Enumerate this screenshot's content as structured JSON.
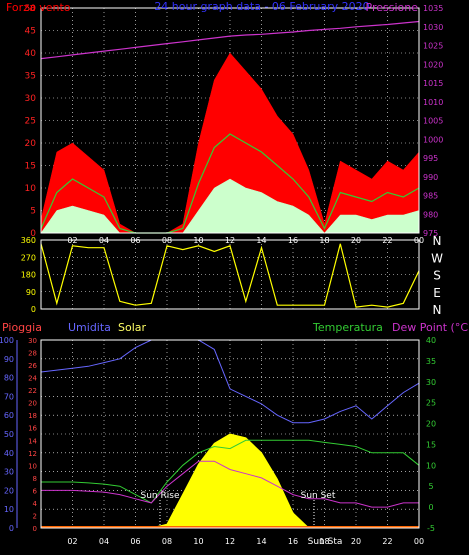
{
  "colors": {
    "background": "#000000",
    "frame": "#ffffff",
    "grid": "#ffffff",
    "wind_gust": "#ff0000",
    "wind_avg": "#33cc33",
    "wind_min": "#ccffcc",
    "pressure": "#cc33cc",
    "direction": "#ffff00",
    "humidity": "#6666ff",
    "rain": "#ff4444",
    "temperature": "#33cc33",
    "dew_point": "#cc33cc",
    "solar": "#ffff00",
    "temp_axis": "#33cc33"
  },
  "top_chart": {
    "title": "24 hour graph data - 06 February 2020",
    "left_label": "Forza vento",
    "right_label": "Pressione",
    "left_ticks": [
      "0",
      "5",
      "10",
      "15",
      "20",
      "25",
      "30",
      "35",
      "40",
      "45",
      "50"
    ],
    "right_ticks": [
      "975",
      "980",
      "985",
      "990",
      "995",
      "1000",
      "1005",
      "1010",
      "1015",
      "1020",
      "1025",
      "1030",
      "1035"
    ],
    "x_ticks": [
      "02",
      "04",
      "06",
      "08",
      "10",
      "12",
      "14",
      "16",
      "18",
      "20",
      "22",
      "00"
    ]
  },
  "direction_chart": {
    "left_ticks": [
      "0",
      "90",
      "180",
      "270",
      "360"
    ],
    "compass": [
      "N",
      "W",
      "S",
      "E",
      "N"
    ],
    "x_ticks": [
      "02",
      "04",
      "06",
      "08",
      "10",
      "12",
      "14",
      "16",
      "18",
      "20",
      "22",
      "00"
    ]
  },
  "bottom_chart": {
    "labels": {
      "rain": "Pioggia",
      "humidity": "Umidita",
      "solar": "Solar",
      "temperature": "Temperatura",
      "dew_point": "Dew Point (°C)"
    },
    "humidity_ticks": [
      "0",
      "10",
      "20",
      "30",
      "40",
      "50",
      "60",
      "70",
      "80",
      "90",
      "100"
    ],
    "rain_ticks": [
      "0",
      "2",
      "4",
      "6",
      "8",
      "10",
      "12",
      "14",
      "16",
      "18",
      "20",
      "22",
      "24",
      "26",
      "28",
      "30"
    ],
    "temp_ticks": [
      "-5",
      "0",
      "5",
      "10",
      "15",
      "20",
      "25",
      "30",
      "35",
      "40"
    ],
    "x_ticks": [
      "02",
      "04",
      "06",
      "08",
      "10",
      "12",
      "14",
      "16",
      "18",
      "20",
      "22",
      "00"
    ],
    "sunrise_label": "Sun Rise",
    "sunset_label": "Sun Set",
    "sunset_extra_label": "Sun Sta"
  },
  "chart_data": [
    {
      "type": "line",
      "title": "24 hour graph data - 06 February 2020",
      "ylabel": "Forza vento",
      "y2label": "Pressione",
      "ylim": [
        0,
        50
      ],
      "y2lim": [
        975,
        1035
      ],
      "x_hours": [
        0,
        1,
        2,
        3,
        4,
        5,
        6,
        7,
        8,
        9,
        10,
        11,
        12,
        13,
        14,
        15,
        16,
        17,
        18,
        19,
        20,
        21,
        22,
        23,
        24
      ],
      "series": [
        {
          "values": [
            3,
            18,
            20,
            17,
            14,
            2,
            0,
            0,
            0,
            2,
            20,
            34,
            40,
            36,
            32,
            26,
            22,
            14,
            2,
            16,
            14,
            12,
            16,
            14,
            18
          ]
        },
        {
          "values": [
            1,
            9,
            12,
            10,
            8,
            1,
            0,
            0,
            0,
            1,
            11,
            19,
            22,
            20,
            18,
            15,
            12,
            8,
            1,
            9,
            8,
            7,
            9,
            8,
            10
          ]
        },
        {
          "values": [
            0,
            5,
            6,
            5,
            4,
            0,
            0,
            0,
            0,
            0,
            5,
            10,
            12,
            10,
            9,
            7,
            6,
            4,
            0,
            4,
            4,
            3,
            4,
            4,
            5
          ]
        },
        {
          "values": [
            1021.5,
            1022,
            1022.5,
            1023,
            1023.5,
            1024,
            1024.5,
            1025,
            1025.5,
            1026,
            1026.5,
            1027,
            1027.5,
            1027.8,
            1028,
            1028.3,
            1028.6,
            1029,
            1029.3,
            1029.6,
            1030,
            1030.3,
            1030.6,
            1031,
            1031.4
          ]
        }
      ]
    },
    {
      "type": "line",
      "ylim": [
        0,
        360
      ],
      "x_hours": [
        0,
        1,
        2,
        3,
        4,
        5,
        6,
        7,
        8,
        9,
        10,
        11,
        12,
        13,
        14,
        15,
        16,
        17,
        18,
        19,
        20,
        21,
        22,
        23,
        24
      ],
      "values": [
        340,
        30,
        330,
        320,
        320,
        40,
        20,
        30,
        330,
        310,
        330,
        300,
        330,
        40,
        320,
        20,
        20,
        20,
        20,
        340,
        10,
        20,
        10,
        30,
        200
      ]
    },
    {
      "type": "line",
      "x_hours": [
        0,
        1,
        2,
        3,
        4,
        5,
        6,
        7,
        8,
        9,
        10,
        11,
        12,
        13,
        14,
        15,
        16,
        17,
        18,
        19,
        20,
        21,
        22,
        23,
        24
      ],
      "series": [
        {
          "values": [
            83,
            84,
            85,
            86,
            88,
            90,
            96,
            100,
            100,
            100,
            100,
            95,
            74,
            70,
            66,
            60,
            56,
            56,
            58,
            62,
            65,
            58,
            65,
            72,
            77
          ]
        },
        {
          "values": [
            6,
            6,
            6,
            5.8,
            5.5,
            5,
            3,
            1,
            6,
            10,
            13,
            14.5,
            14,
            16,
            16,
            16,
            16,
            16,
            15.5,
            15,
            14.5,
            13,
            13,
            13,
            10
          ]
        },
        {
          "values": [
            4,
            4,
            4,
            3.8,
            3.6,
            3,
            2,
            1,
            5,
            8,
            11,
            11,
            9,
            8,
            7,
            5,
            3,
            2,
            2,
            1,
            1,
            0,
            0,
            1,
            1
          ]
        },
        {
          "values": [
            0,
            0,
            0,
            0,
            0,
            0,
            0,
            0,
            0,
            0,
            0,
            0,
            0,
            0,
            0,
            0,
            0,
            0,
            0,
            0,
            0,
            0,
            0,
            0,
            0
          ]
        },
        {
          "values": [
            0,
            0,
            0,
            0,
            0,
            0,
            0,
            0,
            20,
            180,
            340,
            450,
            500,
            480,
            400,
            260,
            80,
            0,
            0,
            0,
            0,
            0,
            0,
            0,
            0
          ]
        }
      ]
    }
  ]
}
